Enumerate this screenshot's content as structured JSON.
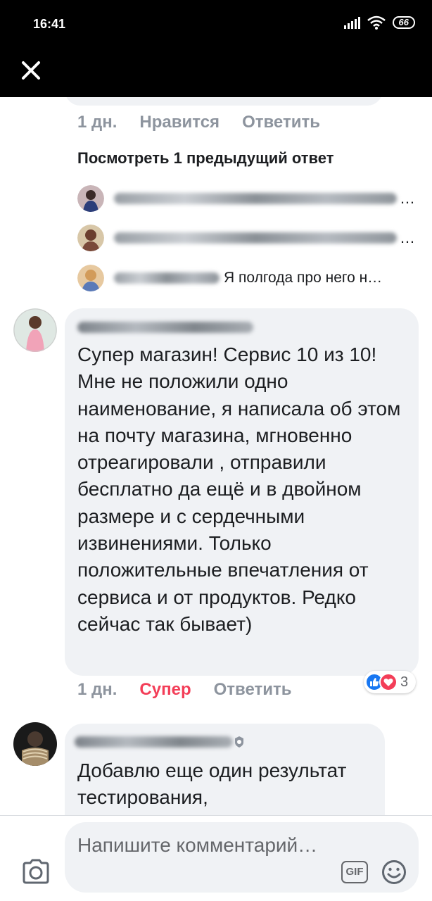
{
  "status_bar": {
    "time": "16:41",
    "battery": "66",
    "icons": [
      "signal-icon",
      "wifi-icon",
      "battery-icon"
    ]
  },
  "header": {
    "close_icon": "close-icon"
  },
  "prev_comment": {
    "time": "1 дн.",
    "like_label": "Нравится",
    "reply_label": "Ответить"
  },
  "replies_section": {
    "view_previous": "Посмотреть 1 предыдущий ответ",
    "replies": [
      {
        "text": "…"
      },
      {
        "text": "…"
      },
      {
        "text": "Я полгода про него н…"
      }
    ]
  },
  "comment_main": {
    "body": "Супер магазин! Сервис 10 из 10! Мне не положили одно наименование, я написала об этом на почту магазина, мгновенно отреагировали , отправили бесплатно да ещё и в двойном размере и с сердечными извинениями. Только положительные впечатления от сервиса и от продуктов. Редко сейчас так бывает)",
    "time": "1 дн.",
    "reaction_label": "Супер",
    "reply_label": "Ответить",
    "reaction_count": "3",
    "reaction_icons": [
      "like-icon",
      "love-icon"
    ],
    "colors": {
      "like": "#1877f2",
      "love": "#f33e58"
    }
  },
  "comment_next": {
    "body": "Добавлю еще один результат тестирования,"
  },
  "composer": {
    "placeholder": "Напишите комментарий…",
    "gif_label": "GIF",
    "icons": [
      "camera-icon",
      "gif-icon",
      "emoji-icon"
    ]
  }
}
